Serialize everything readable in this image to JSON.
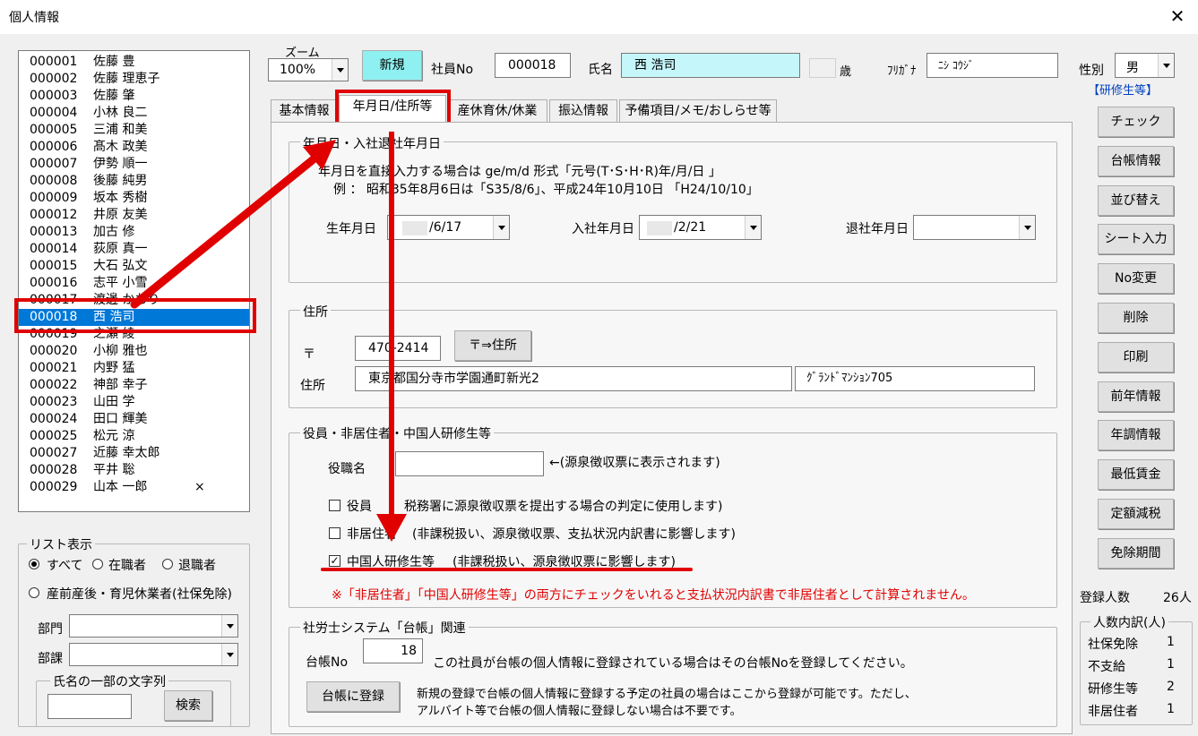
{
  "window": {
    "title": "個人情報",
    "close_icon": "close-icon"
  },
  "employees": [
    {
      "code": "000001",
      "name": "佐藤 豊"
    },
    {
      "code": "000002",
      "name": "佐藤 理恵子"
    },
    {
      "code": "000003",
      "name": "佐藤 肇"
    },
    {
      "code": "000004",
      "name": "小林 良二"
    },
    {
      "code": "000005",
      "name": "三浦 和美"
    },
    {
      "code": "000006",
      "name": "髙木 政美"
    },
    {
      "code": "000007",
      "name": "伊勢 順一"
    },
    {
      "code": "000008",
      "name": "後藤 純男"
    },
    {
      "code": "000009",
      "name": "坂本 秀樹"
    },
    {
      "code": "000012",
      "name": "井原 友美"
    },
    {
      "code": "000013",
      "name": "加古 修"
    },
    {
      "code": "000014",
      "name": "荻原 真一"
    },
    {
      "code": "000015",
      "name": "大石 弘文"
    },
    {
      "code": "000016",
      "name": "志平 小雪"
    },
    {
      "code": "000017",
      "name": "渡邊 かおり"
    },
    {
      "code": "000018",
      "name": "西 浩司"
    },
    {
      "code": "000019",
      "name": "之瀬 綾"
    },
    {
      "code": "000020",
      "name": "小柳 雅也"
    },
    {
      "code": "000021",
      "name": "内野 猛"
    },
    {
      "code": "000022",
      "name": "神部 幸子"
    },
    {
      "code": "000023",
      "name": "山田 学"
    },
    {
      "code": "000024",
      "name": "田口 輝美"
    },
    {
      "code": "000025",
      "name": "松元 涼"
    },
    {
      "code": "000027",
      "name": "近藤 幸太郎"
    },
    {
      "code": "000028",
      "name": "平井 聡"
    },
    {
      "code": "000029",
      "name": "山本 一郎",
      "mark": "×"
    }
  ],
  "list_display": {
    "legend": "リスト表示",
    "radio_all": "すべて",
    "radio_employed": "在職者",
    "radio_retired": "退職者",
    "radio_leave": "産前産後・育児休業者(社保免除)",
    "dept_label": "部門",
    "section_label": "部課",
    "name_search_legend": "氏名の一部の文字列",
    "search_button": "検索"
  },
  "header": {
    "zoom_label": "ズーム",
    "zoom_value": "100%",
    "new_button": "新規",
    "emp_no_label": "社員No",
    "emp_no_value": "000018",
    "name_label": "氏名",
    "name_value": "西 浩司",
    "age_suffix": "歳",
    "furigana_label": "ﾌﾘｶﾞﾅ",
    "furigana_value": "ﾆｼ ｺｳｼﾞ",
    "gender_label": "性別",
    "gender_value": "男",
    "trainee_badge": "【研修生等】"
  },
  "tabs": [
    {
      "label": "基本情報"
    },
    {
      "label": "年月日/住所等"
    },
    {
      "label": "産休育休/休業"
    },
    {
      "label": "振込情報"
    },
    {
      "label": "予備項目/メモ/おしらせ等"
    }
  ],
  "dates_group": {
    "legend": "年月日・入社退社年月日",
    "help_line1": "年月日を直接入力する場合は ge/m/d  形式「元号(T･S･H･R)年/月/日 」",
    "help_line2": "例  ：  昭和35年8月6日は「S35/8/6」、平成24年10月10日 「H24/10/10」",
    "birth_label": "生年月日",
    "birth_value": "/6/17",
    "join_label": "入社年月日",
    "join_value": "/2/21",
    "leave_label": "退社年月日",
    "leave_value": ""
  },
  "address_group": {
    "legend": "住所",
    "postal_mark": "〒",
    "postal_value": "470-2414",
    "postal_button": "〒⇒住所",
    "address_label": "住所",
    "address_value": "東京都国分寺市学園通町新光2",
    "building_value": "ｸﾞﾗﾝﾄﾞﾏﾝｼｮﾝ705"
  },
  "officer_group": {
    "legend": "役員・非居住者・中国人研修生等",
    "title_label": "役職名",
    "title_note": "←(源泉徴収票に表示されます)",
    "officer_label": "役員",
    "officer_note": "税務署に源泉徴収票を提出する場合の判定に使用します)",
    "nonresident_label": "非居住者",
    "nonresident_note": "(非課税扱い、源泉徴収票、支払状況内訳書に影響します)",
    "trainee_label": "中国人研修生等",
    "trainee_note": "(非課税扱い、源泉徴収票に影響します)",
    "warning": "※「非居住者」「中国人研修生等」の両方にチェックをいれると支払状況内訳書で非居住者として計算されません。"
  },
  "ledger_group": {
    "legend": "社労士システム「台帳」関連",
    "ledger_no_label": "台帳No",
    "ledger_no_value": "18",
    "ledger_note": "この社員が台帳の個人情報に登録されている場合はその台帳Noを登録してください。",
    "register_button": "台帳に登録",
    "register_note1": "新規の登録で台帳の個人情報に登録する予定の社員の場合はここから登録が可能です。ただし、",
    "register_note2": "アルバイト等で台帳の個人情報に登録しない場合は不要です。"
  },
  "side_buttons": [
    {
      "label": "チェック"
    },
    {
      "label": "台帳情報"
    },
    {
      "label": "並び替え"
    },
    {
      "label": "シート入力"
    },
    {
      "label": "No変更"
    },
    {
      "label": "削除"
    },
    {
      "label": "印刷"
    },
    {
      "label": "前年情報"
    },
    {
      "label": "年調情報"
    },
    {
      "label": "最低賃金"
    },
    {
      "label": "定額減税"
    },
    {
      "label": "免除期間"
    }
  ],
  "stats": {
    "registered_label": "登録人数",
    "registered_value": "26人",
    "breakdown_legend": "人数内訳(人)",
    "rows": [
      {
        "label": "社保免除",
        "value": "1"
      },
      {
        "label": "不支給",
        "value": "1"
      },
      {
        "label": "研修生等",
        "value": "2"
      },
      {
        "label": "非居住者",
        "value": "1"
      }
    ]
  },
  "colors": {
    "highlight_red": "#e00000",
    "selection_blue": "#0078d7",
    "new_button_bg": "#8ef0f0",
    "name_field_bg": "#c4f6fa",
    "badge_blue": "#0040c0"
  }
}
